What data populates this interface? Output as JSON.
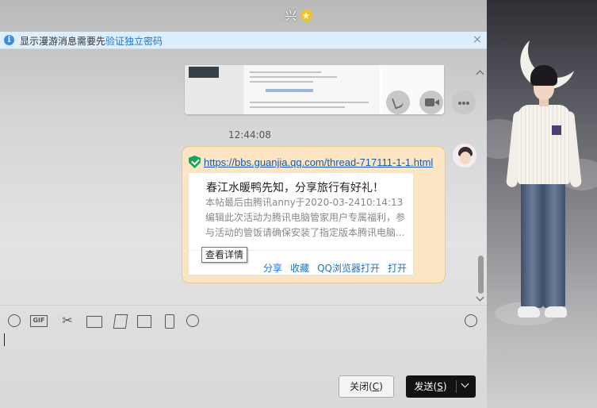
{
  "window": {
    "title": "兴",
    "title_badge_icon": "crown-badge-icon"
  },
  "notice": {
    "text": "显示漫游消息需要先",
    "link": "验证独立密码",
    "close": "×"
  },
  "chat": {
    "timestamp": "12:44:08",
    "link_message": {
      "url": "https://bbs.guanjia.qq.com/thread-717111-1-1.html",
      "card_title": "春江水暖鸭先知，分享旅行有好礼！",
      "card_body": "本帖最后由腾讯anny于2020-03-2410:14:13编辑此次活动为腾讯电脑管家用户专属福利，参与活动的管饭请确保安装了指定版本腾讯电脑...",
      "tooltip": "查看详情",
      "actions": [
        "分享",
        "收藏",
        "QQ浏览器打开",
        "打开"
      ]
    }
  },
  "toolbar": {
    "icons": [
      "emoji-icon",
      "gif-icon",
      "screenshot-scissors-icon",
      "folder-icon",
      "picture-card-icon",
      "image-icon",
      "shake-icon",
      "more-icon",
      "history-clock-icon"
    ],
    "gif_label": "GIF"
  },
  "buttons": {
    "close_label": "关闭(",
    "close_key": "C",
    "close_suffix": ")",
    "send_label": "发送(",
    "send_key": "S",
    "send_suffix": ")"
  },
  "colors": {
    "notice_bg": "#dfeefb",
    "link": "#1a74d1",
    "bubble_bg": "#fbe5c2",
    "send_button": "#121212"
  }
}
